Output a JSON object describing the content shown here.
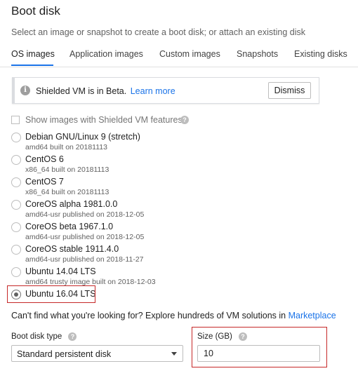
{
  "header": {
    "title": "Boot disk",
    "subtitle": "Select an image or snapshot to create a boot disk; or attach an existing disk"
  },
  "tabs": [
    {
      "label": "OS images",
      "active": true
    },
    {
      "label": "Application images",
      "active": false
    },
    {
      "label": "Custom images",
      "active": false
    },
    {
      "label": "Snapshots",
      "active": false
    },
    {
      "label": "Existing disks",
      "active": false
    }
  ],
  "banner": {
    "icon": "info-icon",
    "text": "Shielded VM is in Beta.",
    "link": "Learn more",
    "dismiss_label": "Dismiss"
  },
  "shielded_filter": {
    "label": "Show images with Shielded VM features",
    "checked": false
  },
  "images": [
    {
      "name": "Debian GNU/Linux 9 (stretch)",
      "desc": "amd64 built on 20181113",
      "selected": false
    },
    {
      "name": "CentOS 6",
      "desc": "x86_64 built on 20181113",
      "selected": false
    },
    {
      "name": "CentOS 7",
      "desc": "x86_64 built on 20181113",
      "selected": false
    },
    {
      "name": "CoreOS alpha 1981.0.0",
      "desc": "amd64-usr published on 2018-12-05",
      "selected": false
    },
    {
      "name": "CoreOS beta 1967.1.0",
      "desc": "amd64-usr published on 2018-12-05",
      "selected": false
    },
    {
      "name": "CoreOS stable 1911.4.0",
      "desc": "amd64-usr published on 2018-11-27",
      "selected": false
    },
    {
      "name": "Ubuntu 14.04 LTS",
      "desc": "amd64 trusty image built on 2018-12-03",
      "selected": false
    },
    {
      "name": "Ubuntu 16.04 LTS",
      "desc": "",
      "selected": true
    }
  ],
  "explore": {
    "text": "Can't find what you're looking for? Explore hundreds of VM solutions in ",
    "link": "Marketplace"
  },
  "boot_disk_type": {
    "label": "Boot disk type",
    "value": "Standard persistent disk"
  },
  "size": {
    "label": "Size (GB)",
    "value": "10"
  },
  "colors": {
    "accent": "#1a73e8",
    "highlight_border": "#c62828"
  }
}
